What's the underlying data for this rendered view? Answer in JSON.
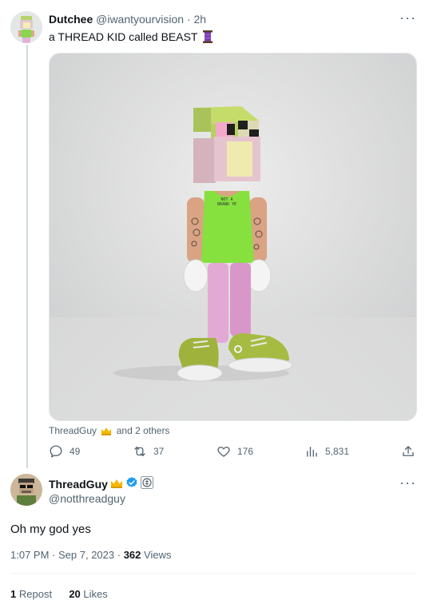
{
  "tweet": {
    "author_name": "Dutchee",
    "author_handle": "@iwantyourvision",
    "separator": "·",
    "time_ago": "2h",
    "text": "a THREAD KID called BEAST",
    "image_caption_shirt": "NOT A\nBRAND YE",
    "tagged_user": "ThreadGuy",
    "tagged_others": "and 2 others",
    "replies": "49",
    "reposts": "37",
    "likes": "176",
    "views": "5,831"
  },
  "reply": {
    "author_name": "ThreadGuy",
    "author_handle": "@notthreadguy",
    "text": "Oh my god yes",
    "time": "1:07 PM",
    "date": "Sep 7, 2023",
    "views_count": "362",
    "views_label": "Views",
    "repost_count": "1",
    "repost_label": "Repost",
    "likes_count": "20",
    "likes_label": "Likes"
  },
  "colors": {
    "verified_blue": "#1d9bf0",
    "crown_gold": "#f5b700",
    "shirt_green": "#85e33f",
    "pants_pink": "#e4a9d6"
  }
}
